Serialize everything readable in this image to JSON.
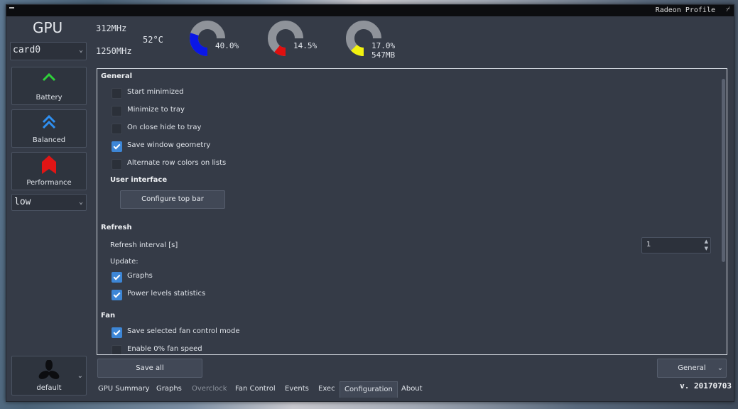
{
  "window": {
    "title": "Radeon Profile"
  },
  "gpu": {
    "label": "GPU",
    "card": "card0",
    "core_clock": "312MHz",
    "mem_clock": "1250MHz",
    "temperature": "52°C"
  },
  "gauges": [
    {
      "value_text": "40.0%",
      "extra_text": "",
      "fraction": 0.4,
      "color": "#0a17e6"
    },
    {
      "value_text": "14.5%",
      "extra_text": "",
      "fraction": 0.145,
      "color": "#e00f0f"
    },
    {
      "value_text": "17.0%",
      "extra_text": "547MB",
      "fraction": 0.17,
      "color": "#f2f20f"
    }
  ],
  "profiles": {
    "battery": "Battery",
    "balanced": "Balanced",
    "performance": "Performance",
    "power_level": "low",
    "fan_profile": "default"
  },
  "config": {
    "general": {
      "title": "General",
      "start_minimized": {
        "label": "Start minimized",
        "checked": false
      },
      "minimize_to_tray": {
        "label": "Minimize to tray",
        "checked": false
      },
      "close_hide_tray": {
        "label": "On close hide to tray",
        "checked": false
      },
      "save_geometry": {
        "label": "Save window geometry",
        "checked": true
      },
      "alt_row_colors": {
        "label": "Alternate row colors on lists",
        "checked": false
      }
    },
    "ui": {
      "title": "User interface",
      "configure_top_bar": "Configure top bar"
    },
    "refresh": {
      "title": "Refresh",
      "interval_label": "Refresh interval [s]",
      "interval_value": "1",
      "update_label": "Update:",
      "graphs": {
        "label": "Graphs",
        "checked": true
      },
      "power_levels": {
        "label": "Power levels statistics",
        "checked": true
      }
    },
    "fan": {
      "title": "Fan",
      "save_fan_mode": {
        "label": "Save selected fan control mode",
        "checked": true
      },
      "enable_zero": {
        "label": "Enable 0% fan speed",
        "checked": false
      }
    }
  },
  "footer": {
    "save_all": "Save all",
    "section_select": "General"
  },
  "tabs": [
    "GPU Summary",
    "Graphs",
    "Overclock",
    "Fan Control",
    "Events",
    "Exec",
    "Configuration",
    "About"
  ],
  "version": "v. 20170703",
  "colors": {
    "battery": "#2fd13a",
    "balanced": "#2f8ff0",
    "performance": "#e01515",
    "check": "#3d86d6"
  }
}
